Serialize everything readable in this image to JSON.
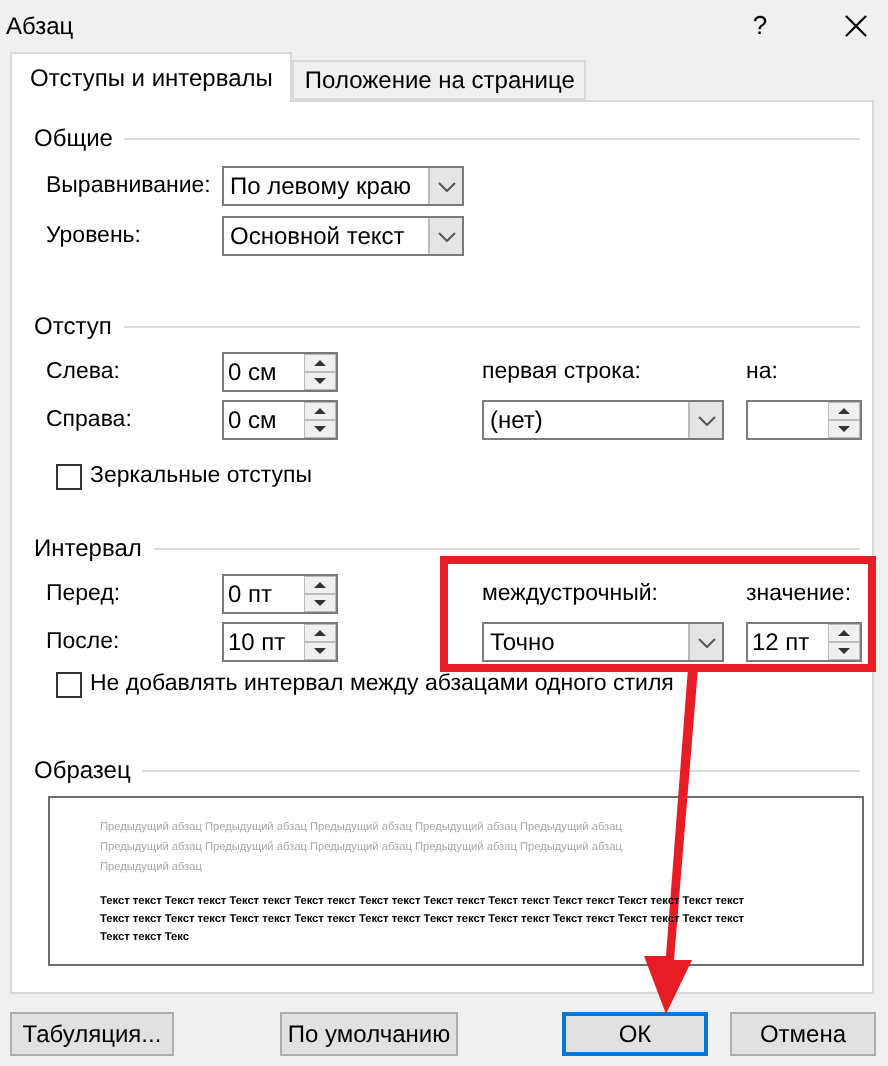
{
  "window": {
    "title": "Абзац",
    "help": "?"
  },
  "tabs": [
    {
      "label": "Отступы и интервалы",
      "selected": true
    },
    {
      "label": "Положение на странице",
      "selected": false
    }
  ],
  "general": {
    "title": "Общие",
    "fields": [
      {
        "label": "Выравнивание:",
        "value": "По левому краю"
      },
      {
        "label": "Уровень:",
        "value": "Основной текст"
      }
    ]
  },
  "indent": {
    "title": "Отступ",
    "left": {
      "label": "Слева:",
      "value": "0 см"
    },
    "right": {
      "label": "Справа:",
      "value": "0 см"
    },
    "first_line": {
      "label": "первая строка:",
      "value": "(нет)"
    },
    "by": {
      "label": "на:"
    },
    "mirror": {
      "label": "Зеркальные отступы",
      "checked": false
    }
  },
  "spacing": {
    "title": "Интервал",
    "before": {
      "label": "Перед:",
      "value": "0 пт"
    },
    "after": {
      "label": "После:",
      "value": "10 пт"
    },
    "line_spacing": {
      "label": "междустрочный:",
      "value": "Точно"
    },
    "at": {
      "label": "значение:",
      "value": "12 пт"
    },
    "no_space": {
      "label": "Не добавлять интервал между абзацами одного стиля",
      "checked": false
    }
  },
  "preview": {
    "title": "Образец",
    "lines": [
      {
        "kind": "previous",
        "text": "Предыдущий абзац Предыдущий абзац Предыдущий абзац Предыдущий абзац Предыдущий абзац"
      },
      {
        "kind": "previous",
        "text": "Предыдущий абзац Предыдущий абзац Предыдущий абзац Предыдущий абзац Предыдущий абзац"
      },
      {
        "kind": "previous",
        "text": "Предыдущий абзац"
      },
      {
        "kind": "current",
        "text": "Текст текст Текст текст Текст текст Текст текст Текст текст Текст текст Текст текст Текст текст Текст текст Текст текст"
      },
      {
        "kind": "current",
        "text": "Текст текст Текст текст Текст текст Текст текст Текст текст Текст текст Текст текст Текст текст Текст текст Текст текст"
      },
      {
        "kind": "current",
        "text": "Текст текст Текс"
      }
    ]
  },
  "buttons": [
    {
      "label": "Табуляция...",
      "default": false
    },
    {
      "label": "По умолчанию",
      "default": false
    },
    {
      "label": "ОК",
      "default": true
    },
    {
      "label": "Отмена",
      "default": false
    }
  ]
}
